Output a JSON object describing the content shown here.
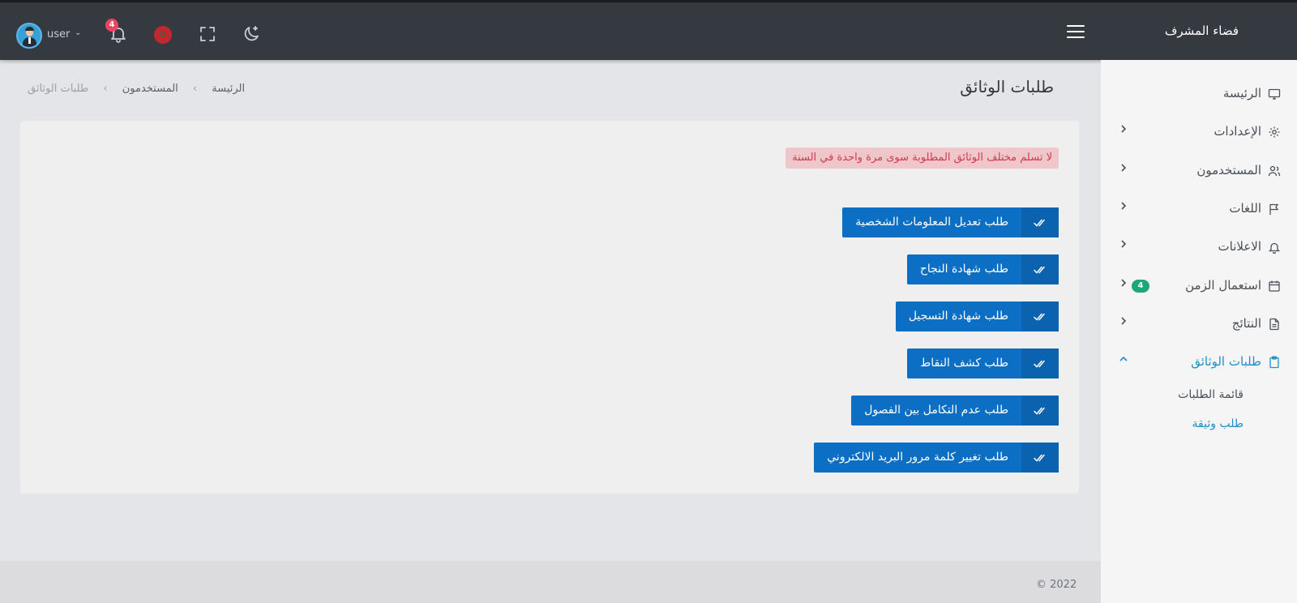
{
  "brand": "فضاء المشرف",
  "topbar": {
    "user_name": "user",
    "notifications_count": "4"
  },
  "page": {
    "title": "طلبات الوثائق",
    "breadcrumb": [
      "الرئيسة",
      "المستخدمون",
      "طلبات الوثائق"
    ]
  },
  "sidebar": {
    "items": [
      {
        "label": "الرئيسة",
        "icon": "monitor-icon"
      },
      {
        "label": "الإعدادات",
        "icon": "gear-icon"
      },
      {
        "label": "المستخدمون",
        "icon": "users-icon"
      },
      {
        "label": "اللغات",
        "icon": "flag-icon"
      },
      {
        "label": "الاعلانات",
        "icon": "bell-icon"
      },
      {
        "label": "استعمال الزمن",
        "icon": "calendar-icon",
        "badge": "4"
      },
      {
        "label": "النتائج",
        "icon": "file-icon"
      },
      {
        "label": "طلبات الوثائق",
        "icon": "clipboard-icon"
      }
    ],
    "sub_items": [
      "قائمة الطلبات",
      "طلب وثيقة"
    ]
  },
  "card": {
    "alert": "لا تسلم مختلف الوثائق المطلوبة سوى مرة واحدة في السنة",
    "buttons": [
      "طلب تعديل المعلومات الشخصية",
      "طلب شهادة النجاح",
      "طلب شهادة التسجيل",
      "طلب كشف النقاط",
      "طلب عدم التكامل بين الفصول",
      "طلب تغيير كلمة مرور البريد الالكتروني"
    ]
  },
  "footer": {
    "copyright": "© 2022"
  },
  "colors": {
    "topbar": "#343a40",
    "primary_button": "#0d6fc3",
    "alert_text": "#d03b4c",
    "active_link": "#1e8fc9",
    "badge_green": "#1fa67a",
    "badge_red": "#ec4561"
  }
}
